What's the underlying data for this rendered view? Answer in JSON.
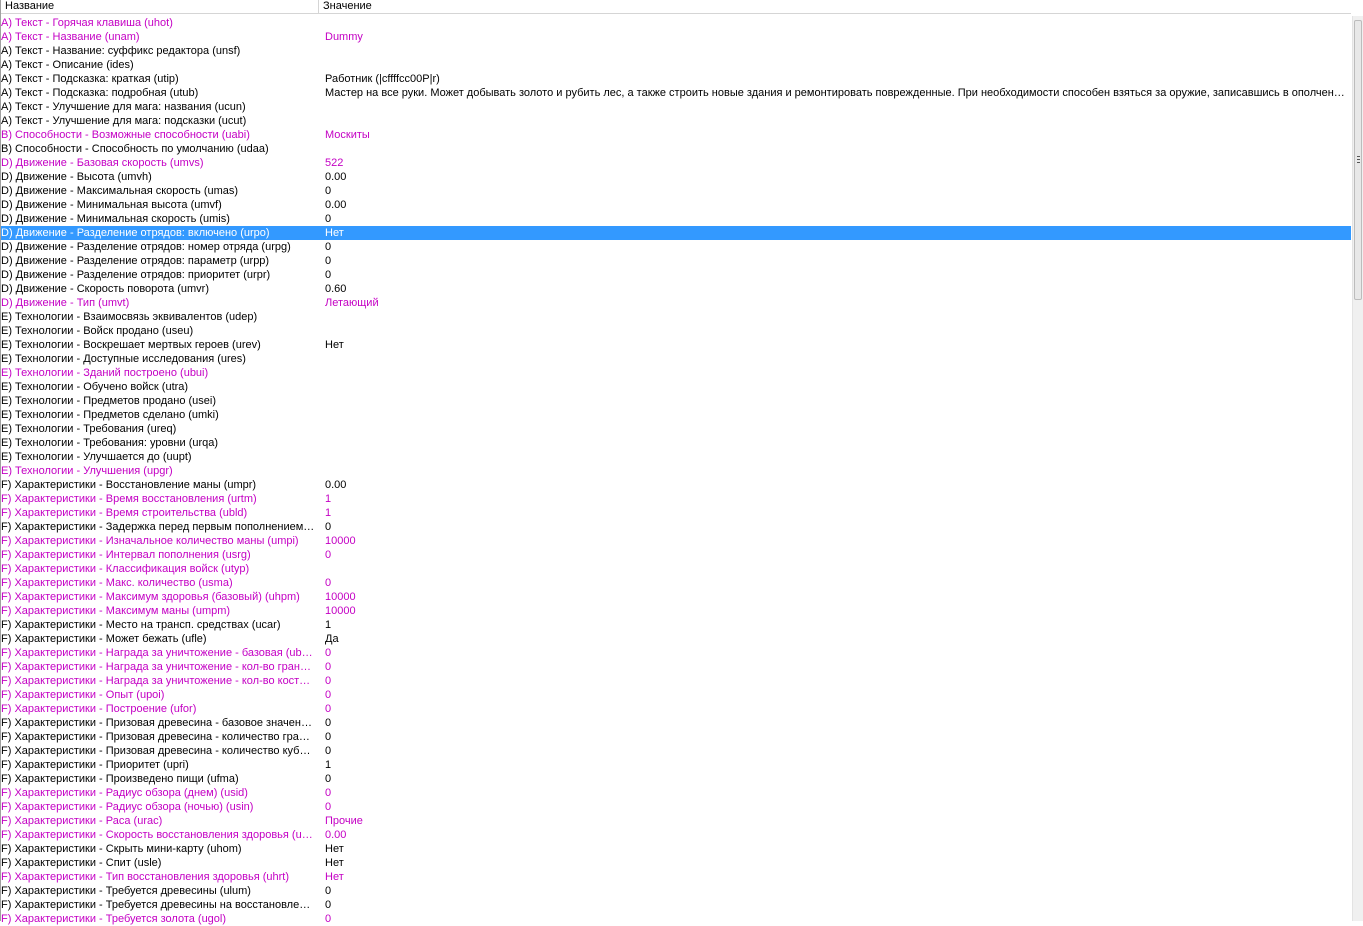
{
  "header": {
    "name_label": "Название",
    "value_label": "Значение"
  },
  "colors": {
    "modified": "#c400c4",
    "selected_bg": "#3399ff",
    "normal": "#000000"
  },
  "rows": [
    {
      "name": "A) Текст - Горячая клавиша (uhot)",
      "value": "",
      "modified": true
    },
    {
      "name": "A) Текст - Название (unam)",
      "value": "Dummy",
      "modified": true
    },
    {
      "name": "A) Текст - Название: суффикс редактора (unsf)",
      "value": ""
    },
    {
      "name": "A) Текст - Описание (ides)",
      "value": ""
    },
    {
      "name": "A) Текст - Подсказка: краткая (utip)",
      "value": "Работник (|cffffcc00P|r)"
    },
    {
      "name": "A) Текст - Подсказка: подробная (utub)",
      "value": "Мастер на все руки. Может добывать золото и рубить лес, а также строить новые здания и ремонтировать поврежденные. При необходимости способен взяться за оружие, записавшись в ополчение."
    },
    {
      "name": "A) Текст - Улучшение для мага: названия (ucun)",
      "value": ""
    },
    {
      "name": "A) Текст - Улучшение для мага: подсказки (ucut)",
      "value": ""
    },
    {
      "name": "B) Способности - Возможные способности (uabi)",
      "value": "Москиты",
      "modified": true
    },
    {
      "name": "B) Способности - Способность по умолчанию (udaa)",
      "value": ""
    },
    {
      "name": "D) Движение - Базовая скорость (umvs)",
      "value": "522",
      "modified": true
    },
    {
      "name": "D) Движение - Высота (umvh)",
      "value": "0.00"
    },
    {
      "name": "D) Движение - Максимальная скорость (umas)",
      "value": "0"
    },
    {
      "name": "D) Движение - Минимальная высота (umvf)",
      "value": "0.00"
    },
    {
      "name": "D) Движение - Минимальная скорость (umis)",
      "value": "0"
    },
    {
      "name": "D) Движение - Разделение отрядов: включено (urpo)",
      "value": "Нет",
      "selected": true
    },
    {
      "name": "D) Движение - Разделение отрядов: номер отряда (urpg)",
      "value": "0"
    },
    {
      "name": "D) Движение - Разделение отрядов: параметр (urpp)",
      "value": "0"
    },
    {
      "name": "D) Движение - Разделение отрядов: приоритет (urpr)",
      "value": "0"
    },
    {
      "name": "D) Движение - Скорость поворота (umvr)",
      "value": "0.60"
    },
    {
      "name": "D) Движение - Тип (umvt)",
      "value": "Летающий",
      "modified": true
    },
    {
      "name": "E) Технологии - Взаимосвязь эквивалентов (udep)",
      "value": ""
    },
    {
      "name": "E) Технологии - Войск продано (useu)",
      "value": ""
    },
    {
      "name": "E) Технологии - Воскрешает мертвых героев (urev)",
      "value": "Нет"
    },
    {
      "name": "E) Технологии - Доступные исследования (ures)",
      "value": ""
    },
    {
      "name": "E) Технологии - Зданий построено (ubui)",
      "value": "",
      "modified": true
    },
    {
      "name": "E) Технологии - Обучено войск (utra)",
      "value": ""
    },
    {
      "name": "E) Технологии - Предметов продано (usei)",
      "value": ""
    },
    {
      "name": "E) Технологии - Предметов сделано (umki)",
      "value": ""
    },
    {
      "name": "E) Технологии - Требования (ureq)",
      "value": ""
    },
    {
      "name": "E) Технологии - Требования: уровни (urqa)",
      "value": ""
    },
    {
      "name": "E) Технологии - Улучшается до (uupt)",
      "value": ""
    },
    {
      "name": "E) Технологии - Улучшения (upgr)",
      "value": "",
      "modified": true
    },
    {
      "name": "F) Характеристики - Восстановление маны (umpr)",
      "value": "0.00"
    },
    {
      "name": "F) Характеристики - Время восстановления (urtm)",
      "value": "1",
      "modified": true
    },
    {
      "name": "F) Характеристики - Время строительства (ubld)",
      "value": "1",
      "modified": true
    },
    {
      "name": "F) Характеристики - Задержка перед первым пополнением маны (umpm)",
      "value": "0"
    },
    {
      "name": "F) Характеристики - Изначальное количество маны (umpi)",
      "value": "10000",
      "modified": true
    },
    {
      "name": "F) Характеристики - Интервал пополнения (usrg)",
      "value": "0",
      "modified": true
    },
    {
      "name": "F) Характеристики - Классификация войск (utyp)",
      "value": "",
      "modified": true
    },
    {
      "name": "F) Характеристики - Макс. количество (usma)",
      "value": "0",
      "modified": true
    },
    {
      "name": "F) Характеристики - Максимум здоровья (базовый) (uhpm)",
      "value": "10000",
      "modified": true
    },
    {
      "name": "F) Характеристики - Максимум маны (umpm)",
      "value": "10000",
      "modified": true
    },
    {
      "name": "F) Характеристики - Место на трансп. средствах (ucar)",
      "value": "1"
    },
    {
      "name": "F) Характеристики - Может бежать (ufle)",
      "value": "Да"
    },
    {
      "name": "F) Характеристики - Награда за уничтожение - базовая (ubba)",
      "value": "0",
      "modified": true
    },
    {
      "name": "F) Характеристики - Награда за уничтожение - кол-во граней (ubsi)",
      "value": "0",
      "modified": true
    },
    {
      "name": "F) Характеристики - Награда за уничтожение - кол-во костей (ubdi)",
      "value": "0",
      "modified": true
    },
    {
      "name": "F) Характеристики - Опыт (upoi)",
      "value": "0",
      "modified": true
    },
    {
      "name": "F) Характеристики - Построение (ufor)",
      "value": "0",
      "modified": true
    },
    {
      "name": "F) Характеристики - Призовая древесина - базовое значение (ulba)",
      "value": "0"
    },
    {
      "name": "F) Характеристики - Призовая древесина - количество граней (ulsi)",
      "value": "0"
    },
    {
      "name": "F) Характеристики - Призовая древесина - количество кубиков (uldi)",
      "value": "0"
    },
    {
      "name": "F) Характеристики - Приоритет (upri)",
      "value": "1"
    },
    {
      "name": "F) Характеристики - Произведено пищи (ufma)",
      "value": "0"
    },
    {
      "name": "F) Характеристики - Радиус обзора (днем) (usid)",
      "value": "0",
      "modified": true
    },
    {
      "name": "F) Характеристики - Радиус обзора (ночью) (usin)",
      "value": "0",
      "modified": true
    },
    {
      "name": "F) Характеристики - Раса (urac)",
      "value": "Прочие",
      "modified": true
    },
    {
      "name": "F) Характеристики - Скорость восстановления здоровья (uhpr)",
      "value": "0.00",
      "modified": true
    },
    {
      "name": "F) Характеристики - Скрыть мини-карту (uhom)",
      "value": "Нет"
    },
    {
      "name": "F) Характеристики - Спит (usle)",
      "value": "Нет"
    },
    {
      "name": "F) Характеристики - Тип восстановления здоровья (uhrt)",
      "value": "Нет",
      "modified": true
    },
    {
      "name": "F) Характеристики - Требуется древесины (ulum)",
      "value": "0"
    },
    {
      "name": "F) Характеристики - Требуется древесины на восстановление (ulur)",
      "value": "0"
    },
    {
      "name": "F) Характеристики - Требуется золота (ugol)",
      "value": "0",
      "modified": true
    }
  ]
}
